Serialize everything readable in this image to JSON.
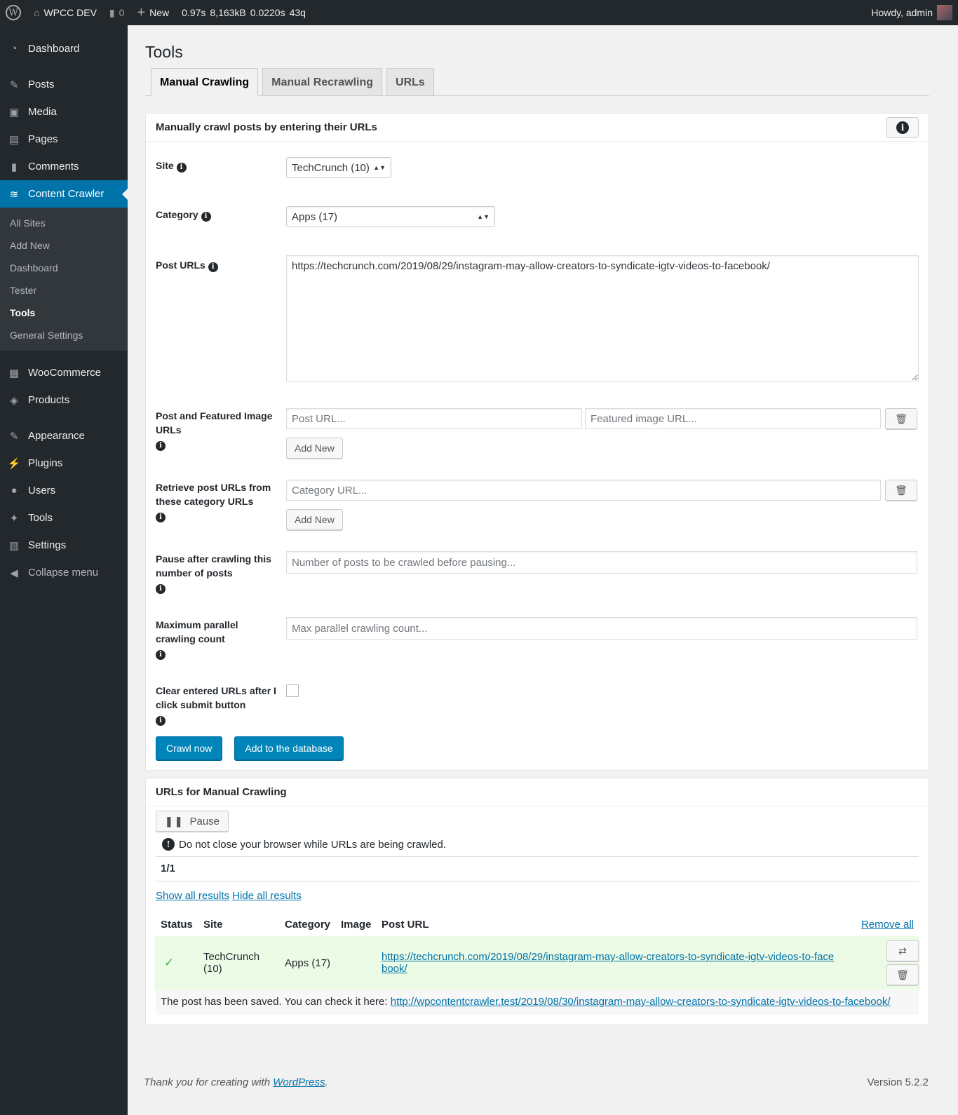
{
  "adminbar": {
    "site": "WPCC DEV",
    "comments": "0",
    "new": "New",
    "time": "0.97s",
    "memory": "8,163kB",
    "query_time": "0.0220s",
    "queries": "43q",
    "howdy": "Howdy, admin"
  },
  "sidebar": {
    "items": [
      {
        "label": "Dashboard",
        "icon": "dashboard-icon"
      },
      {
        "label": "Posts",
        "icon": "pin-icon"
      },
      {
        "label": "Media",
        "icon": "media-icon"
      },
      {
        "label": "Pages",
        "icon": "pages-icon"
      },
      {
        "label": "Comments",
        "icon": "comment-icon"
      },
      {
        "label": "Content Crawler",
        "icon": "crawler-icon"
      }
    ],
    "submenu": [
      "All Sites",
      "Add New",
      "Dashboard",
      "Tester",
      "Tools",
      "General Settings"
    ],
    "items2": [
      {
        "label": "WooCommerce"
      },
      {
        "label": "Products"
      },
      {
        "label": "Appearance"
      },
      {
        "label": "Plugins"
      },
      {
        "label": "Users"
      },
      {
        "label": "Tools"
      },
      {
        "label": "Settings"
      },
      {
        "label": "Collapse menu"
      }
    ]
  },
  "page": {
    "title": "Tools",
    "tabs": [
      "Manual Crawling",
      "Manual Recrawling",
      "URLs"
    ]
  },
  "form": {
    "title": "Manually crawl posts by entering their URLs",
    "site_label": "Site",
    "site_value": "TechCrunch (10)",
    "category_label": "Category",
    "category_value": "Apps (17)",
    "post_urls_label": "Post URLs",
    "post_urls_value": "https://techcrunch.com/2019/08/29/instagram-may-allow-creators-to-syndicate-igtv-videos-to-facebook/",
    "pfi_label": "Post and Featured Image URLs",
    "post_url_placeholder": "Post URL...",
    "featured_placeholder": "Featured image URL...",
    "add_new": "Add New",
    "cat_urls_label": "Retrieve post URLs from these category URLs",
    "cat_url_placeholder": "Category URL...",
    "pause_label": "Pause after crawling this number of posts",
    "pause_placeholder": "Number of posts to be crawled before pausing...",
    "max_label": "Maximum parallel crawling count",
    "max_placeholder": "Max parallel crawling count...",
    "clear_label": "Clear entered URLs after I click submit button",
    "clear_checked": false,
    "crawl_now": "Crawl now",
    "add_db": "Add to the database"
  },
  "results": {
    "title": "URLs for Manual Crawling",
    "pause": "Pause",
    "warning": "Do not close your browser while URLs are being crawled.",
    "progress": "1/1",
    "show_all": "Show all results",
    "hide_all": "Hide all results",
    "columns": [
      "Status",
      "Site",
      "Category",
      "Image",
      "Post URL"
    ],
    "remove_all": "Remove all",
    "rows": [
      {
        "status": "✓",
        "site": "TechCrunch (10)",
        "category": "Apps (17)",
        "image": "",
        "url": "https://techcrunch.com/2019/08/29/instagram-may-allow-creators-to-syndicate-igtv-videos-to-facebook/"
      }
    ],
    "saved_text": "The post has been saved. You can check it here:",
    "saved_url": "http://wpcontentcrawler.test/2019/08/30/instagram-may-allow-creators-to-syndicate-igtv-videos-to-facebook/"
  },
  "footer": {
    "thanks": "Thank you for creating with",
    "wp": "WordPress",
    "version": "Version 5.2.2"
  },
  "colors": {
    "accent": "#0073aa",
    "success_bg": "#ecfbe6",
    "adminbar": "#23282d"
  }
}
